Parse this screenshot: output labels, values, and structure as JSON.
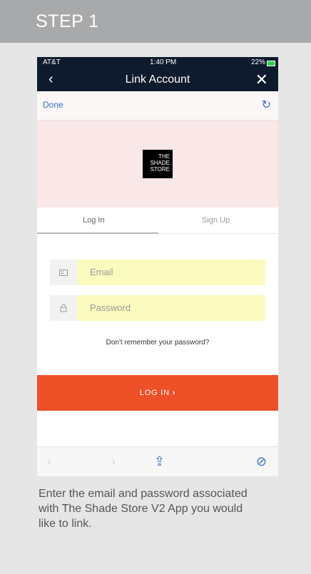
{
  "step": {
    "title": "STEP 1"
  },
  "phone": {
    "status": {
      "carrier": "AT&T",
      "time": "1:40 PM",
      "battery": "22%"
    },
    "nav": {
      "back": "‹",
      "title": "Link Account",
      "close": "✕"
    },
    "toolbar": {
      "done": "Done",
      "refresh": "↻"
    },
    "logo_lines": [
      "THE",
      "SHADE",
      "STORE"
    ],
    "tabs": [
      {
        "label": "Log In"
      },
      {
        "label": "Sign Up"
      }
    ],
    "email": {
      "placeholder": "Email",
      "icon": "id-card-icon"
    },
    "password": {
      "placeholder": "Password",
      "icon": "lock-icon"
    },
    "forgot": "Don't remember your password?",
    "login_button": {
      "label": "LOG IN",
      "chevron": "›"
    },
    "browser_bar": {
      "back": "‹",
      "forward": "›",
      "share": "⇪",
      "compass": "⊘"
    },
    "colors": {
      "accent": "#ee5028",
      "navbar": "#0e1a2d",
      "link": "#3a6fc4"
    }
  },
  "caption": "Enter the email and password associated with The Shade Store V2 App you would like to link."
}
